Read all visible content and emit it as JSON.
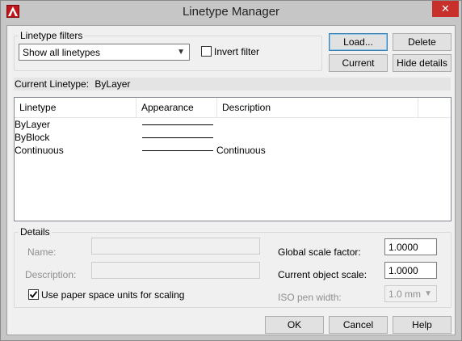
{
  "window": {
    "title": "Linetype Manager",
    "close_glyph": "✕"
  },
  "filters": {
    "group_label": "Linetype filters",
    "selected": "Show all linetypes",
    "invert_label": "Invert filter",
    "invert_checked": false
  },
  "buttons": {
    "load": "Load...",
    "delete": "Delete",
    "current": "Current",
    "hide_details": "Hide details",
    "ok": "OK",
    "cancel": "Cancel",
    "help": "Help"
  },
  "current_linetype": {
    "label": "Current Linetype:",
    "value": "ByLayer"
  },
  "list": {
    "columns": [
      "Linetype",
      "Appearance",
      "Description"
    ],
    "rows": [
      {
        "linetype": "ByLayer",
        "description": ""
      },
      {
        "linetype": "ByBlock",
        "description": ""
      },
      {
        "linetype": "Continuous",
        "description": "Continuous"
      }
    ]
  },
  "details": {
    "group_label": "Details",
    "name_label": "Name:",
    "name_value": "",
    "description_label": "Description:",
    "description_value": "",
    "paper_space_label": "Use paper space units for scaling",
    "paper_space_checked": true,
    "global_scale_label": "Global scale factor:",
    "global_scale_value": "1.0000",
    "object_scale_label": "Current object scale:",
    "object_scale_value": "1.0000",
    "iso_pen_label": "ISO pen width:",
    "iso_pen_value": "1.0 mm"
  },
  "icons": {
    "app": "autocad-logo-icon",
    "dropdown": "chevron-down-icon"
  },
  "colors": {
    "close_button": "#c7302b",
    "app_icon": "#c0151b",
    "default_button_border": "#3c7fb1"
  }
}
